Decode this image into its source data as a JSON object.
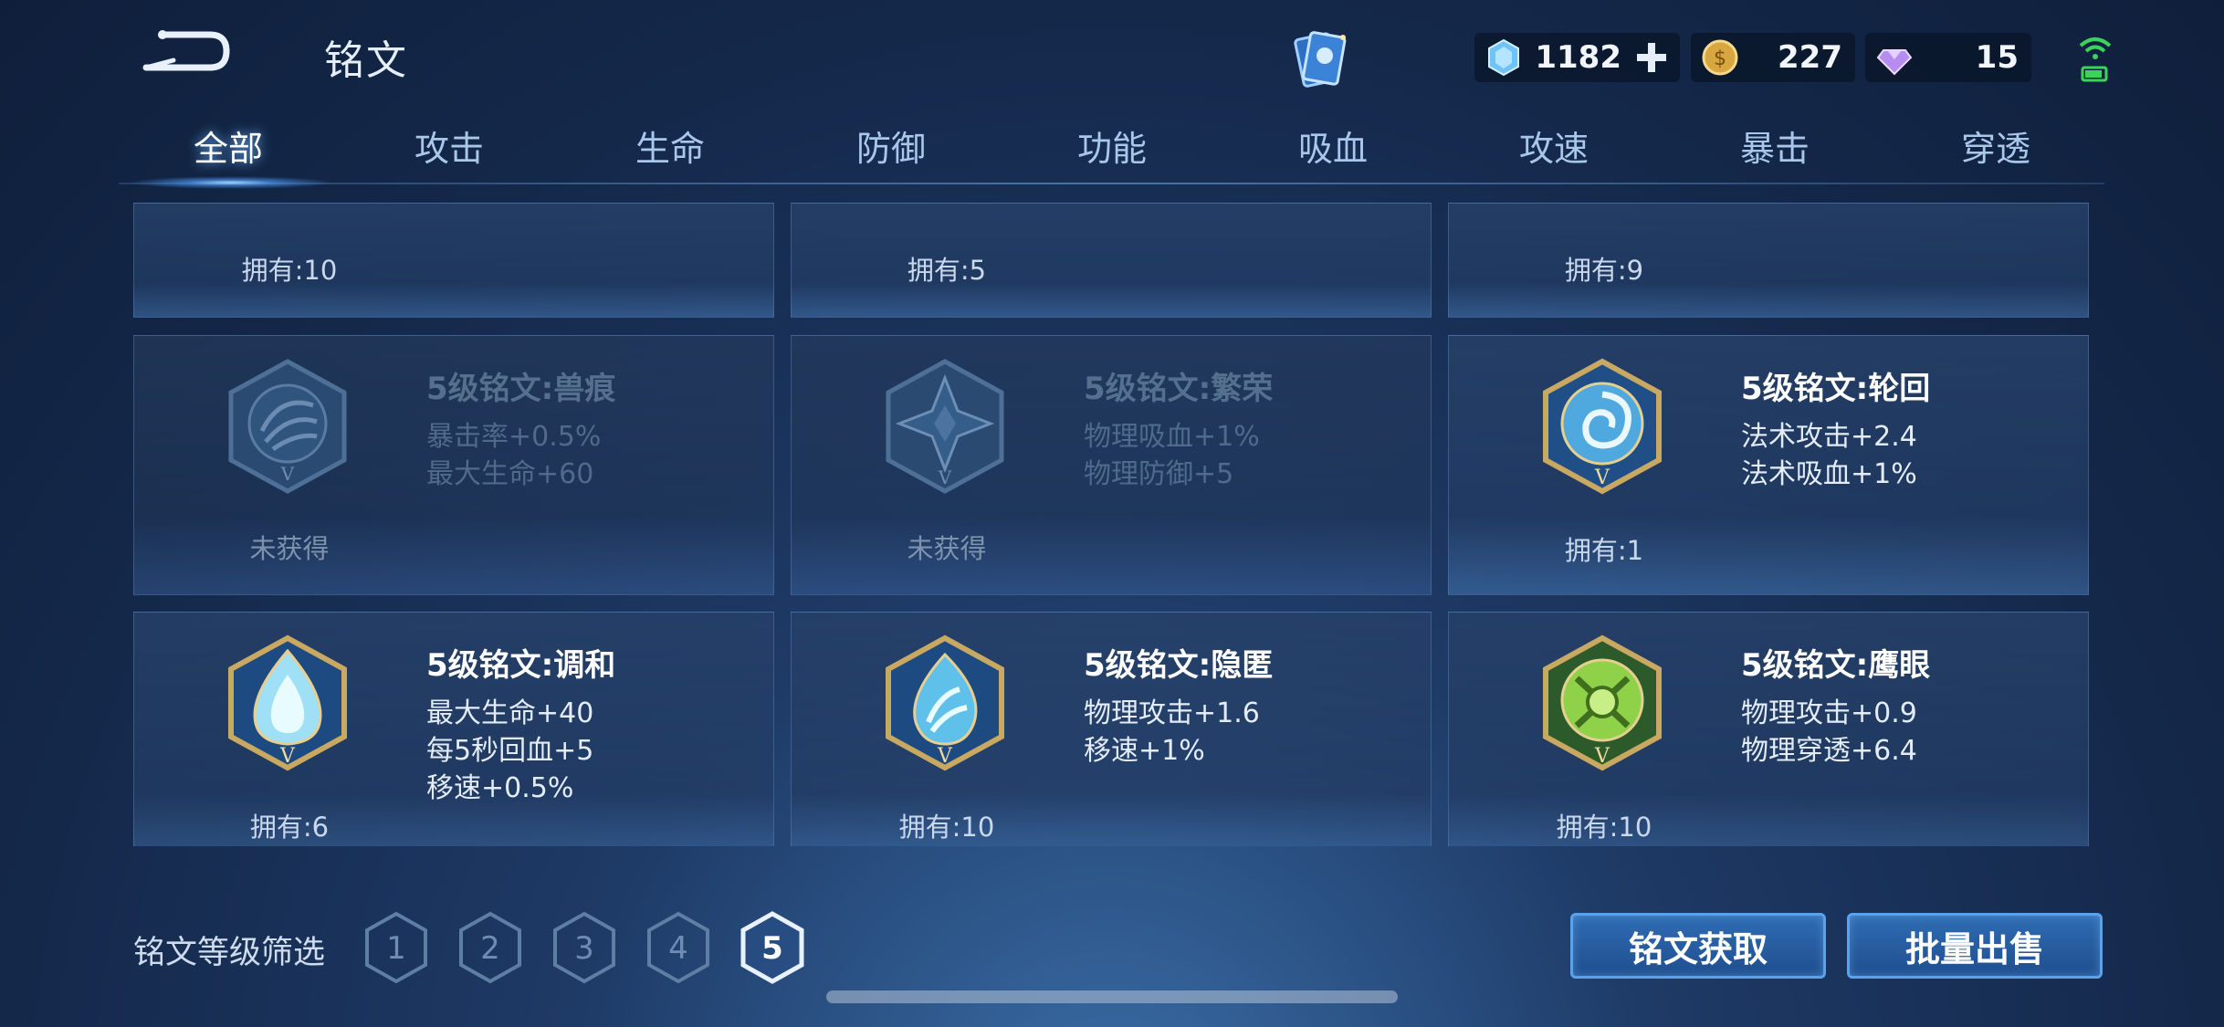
{
  "header": {
    "title": "铭文",
    "currencies": [
      {
        "id": "diamond",
        "icon": "blue-crystal-icon",
        "value": "1182"
      },
      {
        "id": "gold",
        "icon": "gold-coin-icon",
        "value": "227"
      },
      {
        "id": "gem",
        "icon": "purple-gem-icon",
        "value": "15"
      }
    ]
  },
  "tabs": [
    {
      "label": "全部",
      "active": true
    },
    {
      "label": "攻击"
    },
    {
      "label": "生命"
    },
    {
      "label": "防御"
    },
    {
      "label": "功能"
    },
    {
      "label": "吸血"
    },
    {
      "label": "攻速"
    },
    {
      "label": "暴击"
    },
    {
      "label": "穿透"
    }
  ],
  "cards_top_row": [
    {
      "own": "拥有:10"
    },
    {
      "own": "拥有:5"
    },
    {
      "own": "拥有:9"
    }
  ],
  "cards": [
    {
      "name": "5级铭文:兽痕",
      "attrs": [
        "暴击率+0.5%",
        "最大生命+60"
      ],
      "own": "未获得",
      "locked": true,
      "color": "#3a5f87",
      "icon": "beast-mark-emblem-icon"
    },
    {
      "name": "5级铭文:繁荣",
      "attrs": [
        "物理吸血+1%",
        "物理防御+5"
      ],
      "own": "未获得",
      "locked": true,
      "color": "#3a5f87",
      "icon": "prosperity-emblem-icon"
    },
    {
      "name": "5级铭文:轮回",
      "attrs": [
        "法术攻击+2.4",
        "法术吸血+1%"
      ],
      "own": "拥有:1",
      "locked": false,
      "color": "#5fb7e6",
      "icon": "samsara-swirl-emblem-icon"
    },
    {
      "name": "5级铭文:调和",
      "attrs": [
        "最大生命+40",
        "每5秒回血+5",
        "移速+0.5%"
      ],
      "own": "拥有:6",
      "locked": false,
      "color": "#7fd3f0",
      "icon": "harmony-drop-emblem-icon"
    },
    {
      "name": "5级铭文:隐匿",
      "attrs": [
        "物理攻击+1.6",
        "移速+1%"
      ],
      "own": "拥有:10",
      "locked": false,
      "color": "#59bfe6",
      "icon": "stealth-flame-emblem-icon"
    },
    {
      "name": "5级铭文:鹰眼",
      "attrs": [
        "物理攻击+0.9",
        "物理穿透+6.4"
      ],
      "own": "拥有:10",
      "locked": false,
      "color": "#8fd24a",
      "icon": "hawkeye-emblem-icon"
    }
  ],
  "bottom": {
    "filter_label": "铭文等级筛选",
    "levels": [
      "1",
      "2",
      "3",
      "4",
      "5"
    ],
    "selected_level": "5",
    "get_button": "铭文获取",
    "sell_button": "批量出售"
  },
  "colors": {
    "accent": "#5aa3ec",
    "gold_frame": "#c9a862"
  }
}
